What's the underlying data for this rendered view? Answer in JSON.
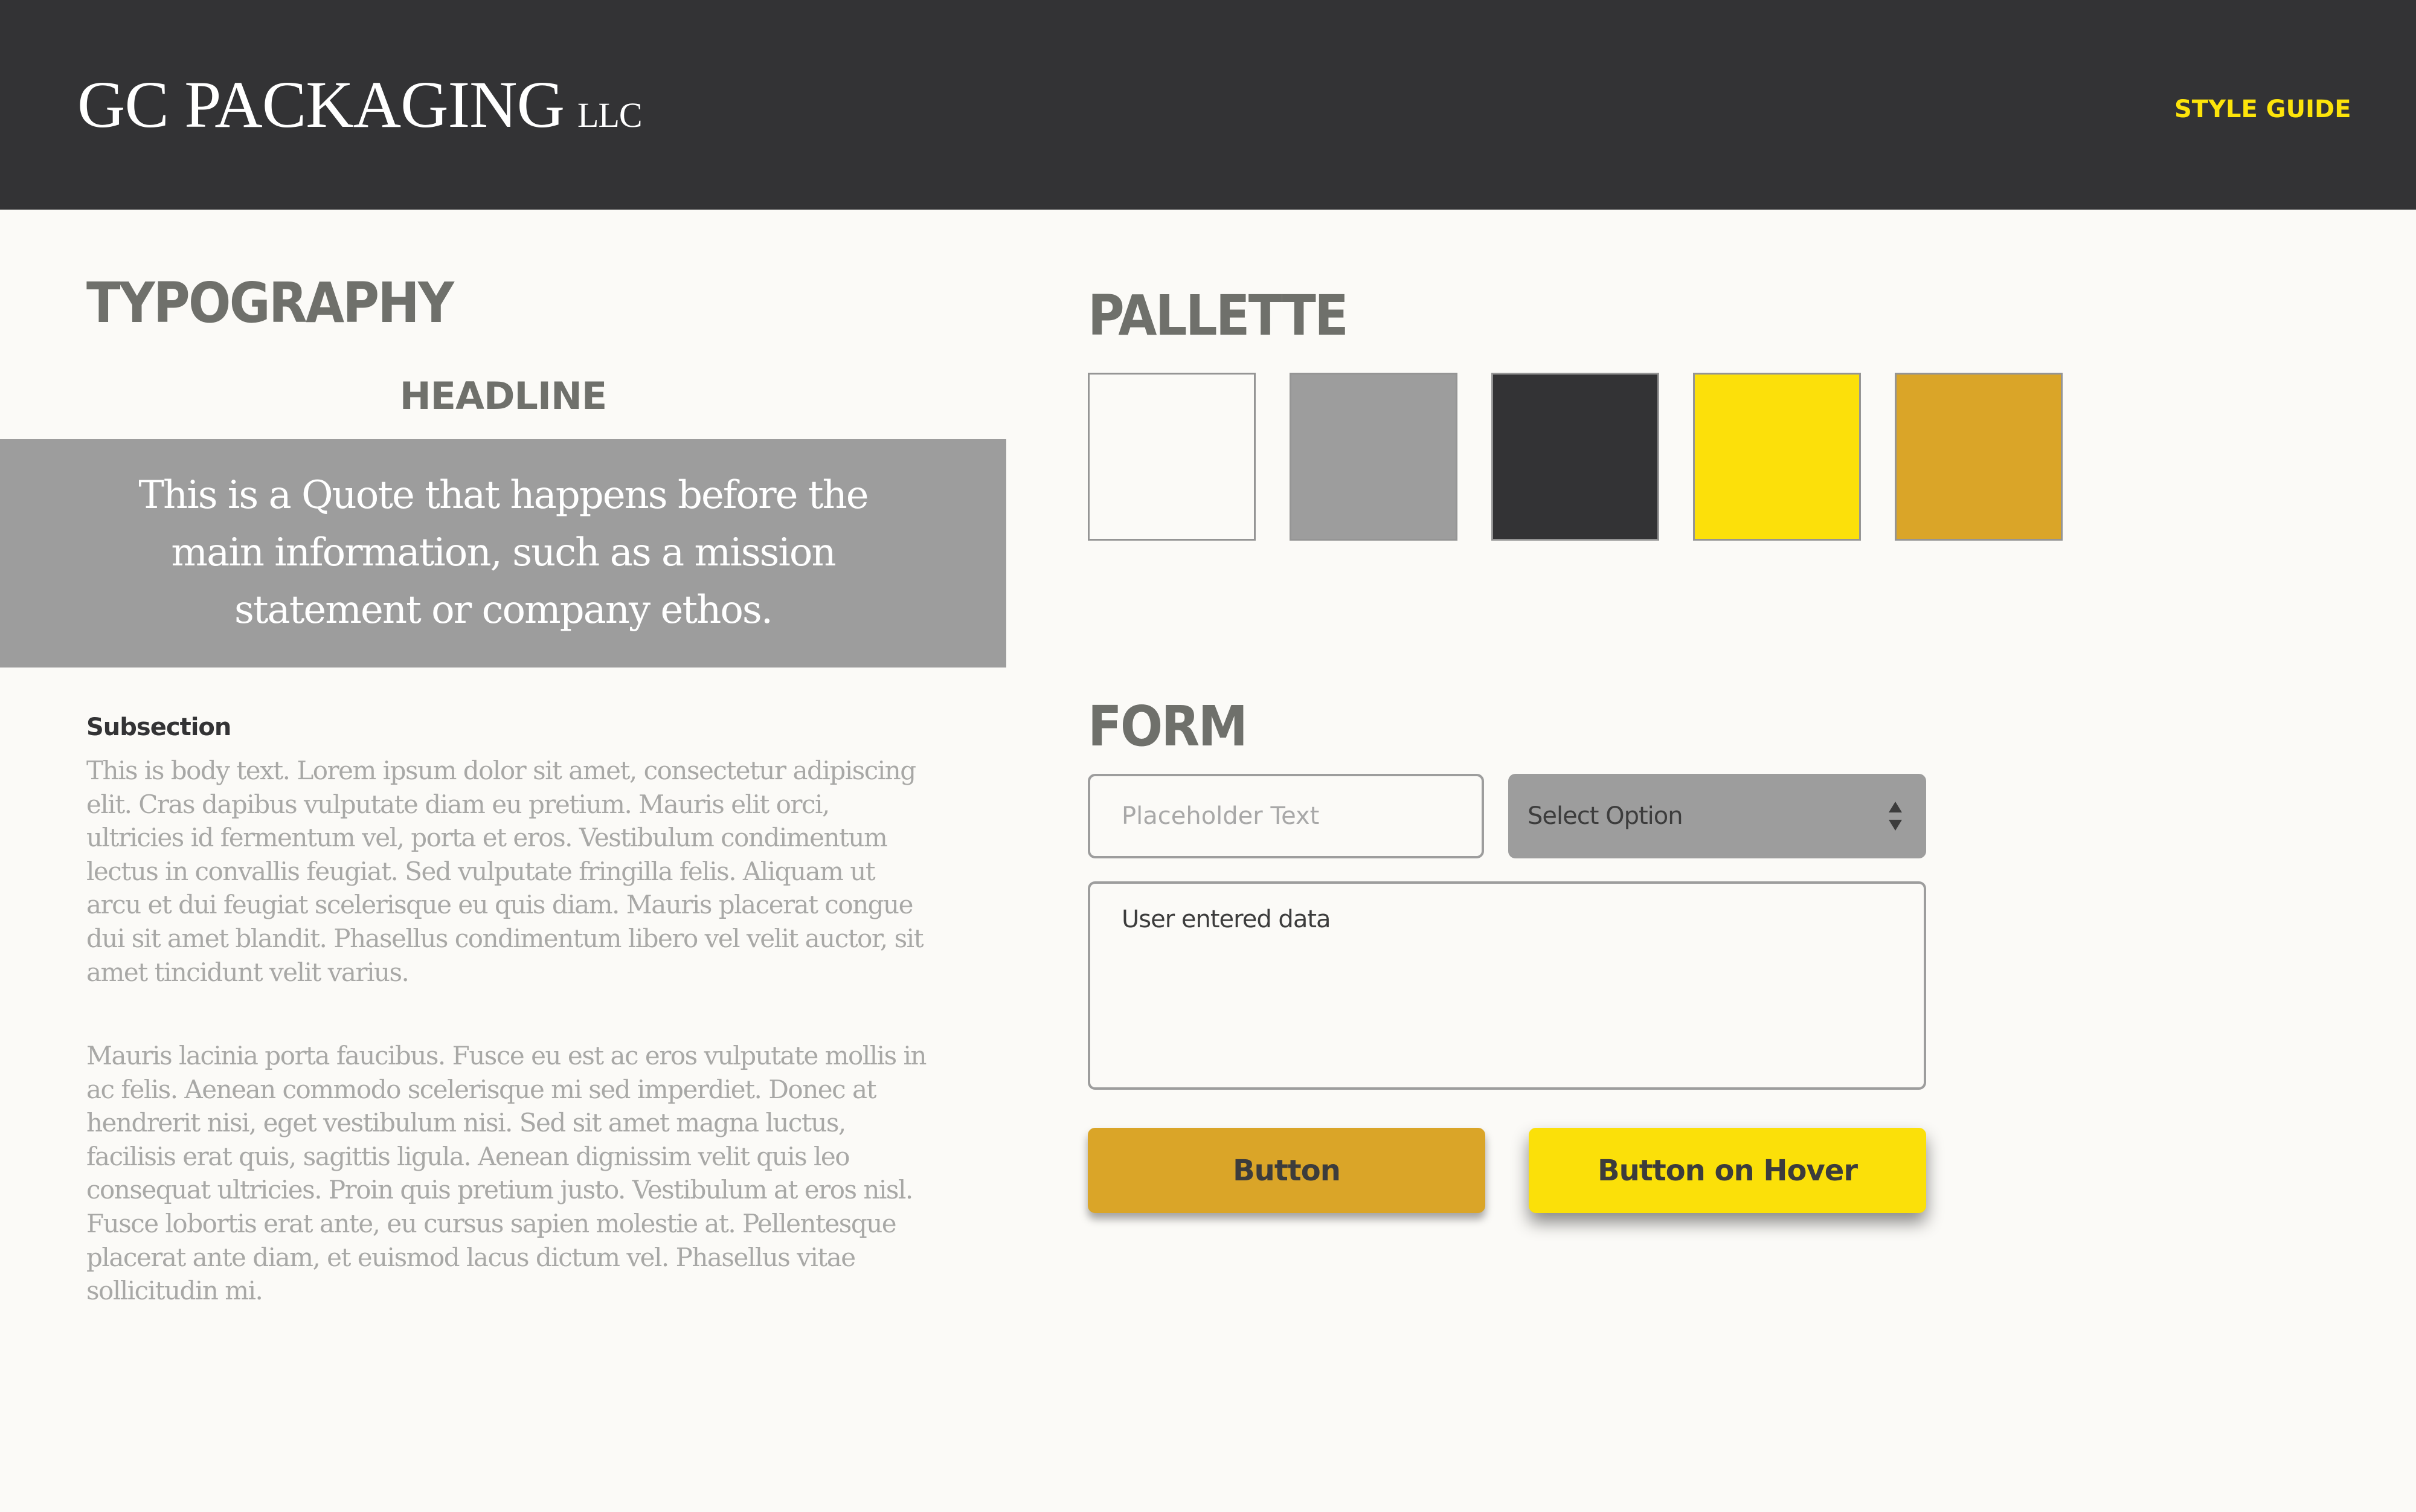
{
  "header": {
    "logo_main": "GC PACKAGING",
    "logo_suffix": "LLC",
    "nav_link": "STYLE GUIDE"
  },
  "typography": {
    "section_title": "TYPOGRAPHY",
    "headline": "HEADLINE",
    "quote": "This is a Quote that happens before the main information, such as a mission statement or company ethos.",
    "subsection": "Subsection",
    "paragraphs": [
      "This is body text. Lorem ipsum dolor sit amet, consectetur adipiscing elit. Cras dapibus vulputate diam eu pretium. Mauris elit orci, ultricies id fermentum vel, porta et eros. Vestibulum condimentum lectus in convallis feugiat. Sed vulputate fringilla felis. Aliquam ut arcu et dui feugiat scelerisque eu quis diam. Mauris placerat congue dui sit amet blandit. Phasellus condimentum libero vel velit auctor, sit amet tincidunt velit varius.",
      "Mauris lacinia porta faucibus. Fusce eu est ac eros vulputate mollis in ac felis. Aenean commodo scelerisque mi sed imperdiet. Donec at hendrerit nisi, eget vestibulum nisi. Sed sit amet magna luctus, facilisis erat quis, sagittis ligula. Aenean dignissim velit quis leo consequat ultricies. Proin quis pretium justo. Vestibulum at eros nisl. Fusce lobortis erat ante, eu cursus sapien molestie at. Pellentesque placerat ante diam, et euismod lacus dictum vel. Phasellus vitae sollicitudin mi."
    ]
  },
  "palette": {
    "section_title": "PALLETTE",
    "swatches": [
      {
        "name": "off-white",
        "color": "#fbfaf7"
      },
      {
        "name": "gray",
        "color": "#9d9d9d"
      },
      {
        "name": "charcoal",
        "color": "#333335"
      },
      {
        "name": "yellow",
        "color": "#fce00a"
      },
      {
        "name": "gold",
        "color": "#daa528"
      }
    ]
  },
  "form": {
    "section_title": "FORM",
    "text_input": {
      "placeholder": "Placeholder Text",
      "value": ""
    },
    "select": {
      "selected": "Select Option",
      "icon": "updown-arrows-icon"
    },
    "textarea": {
      "value": "User entered data"
    },
    "button_label": "Button",
    "button_hover_label": "Button on Hover"
  }
}
